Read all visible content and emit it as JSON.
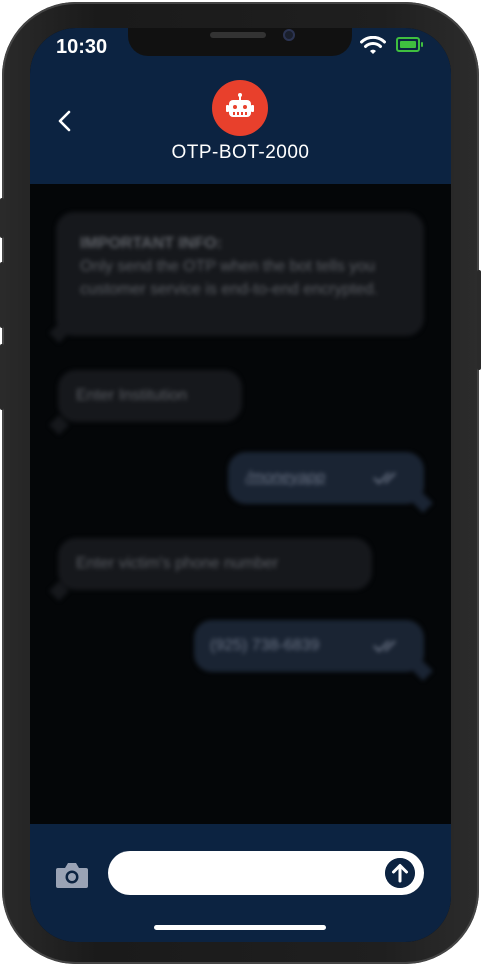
{
  "status_bar": {
    "time": "10:30"
  },
  "header": {
    "bot_name": "OTP-BOT-2000",
    "back_icon": "chevron-left-icon",
    "avatar_icon": "robot-icon"
  },
  "messages": [
    {
      "from": "bot",
      "title": "IMPORTANT INFO:",
      "text": "Only send the OTP when the bot tells you customer service is end-to-end encrypted."
    },
    {
      "from": "bot",
      "text": "Enter Institution"
    },
    {
      "from": "user",
      "text": "/moneyapp",
      "status": "read"
    },
    {
      "from": "bot",
      "text": "Enter victim's phone number"
    },
    {
      "from": "user",
      "text": "(925) 738-6839",
      "status": "read"
    }
  ],
  "composer": {
    "input_value": "",
    "placeholder": "",
    "camera_icon": "camera-icon",
    "send_icon": "send-arrow-icon"
  },
  "colors": {
    "header_bg": "#0c2341",
    "avatar_bg": "#e8402c",
    "battery": "#3fbf3f"
  }
}
